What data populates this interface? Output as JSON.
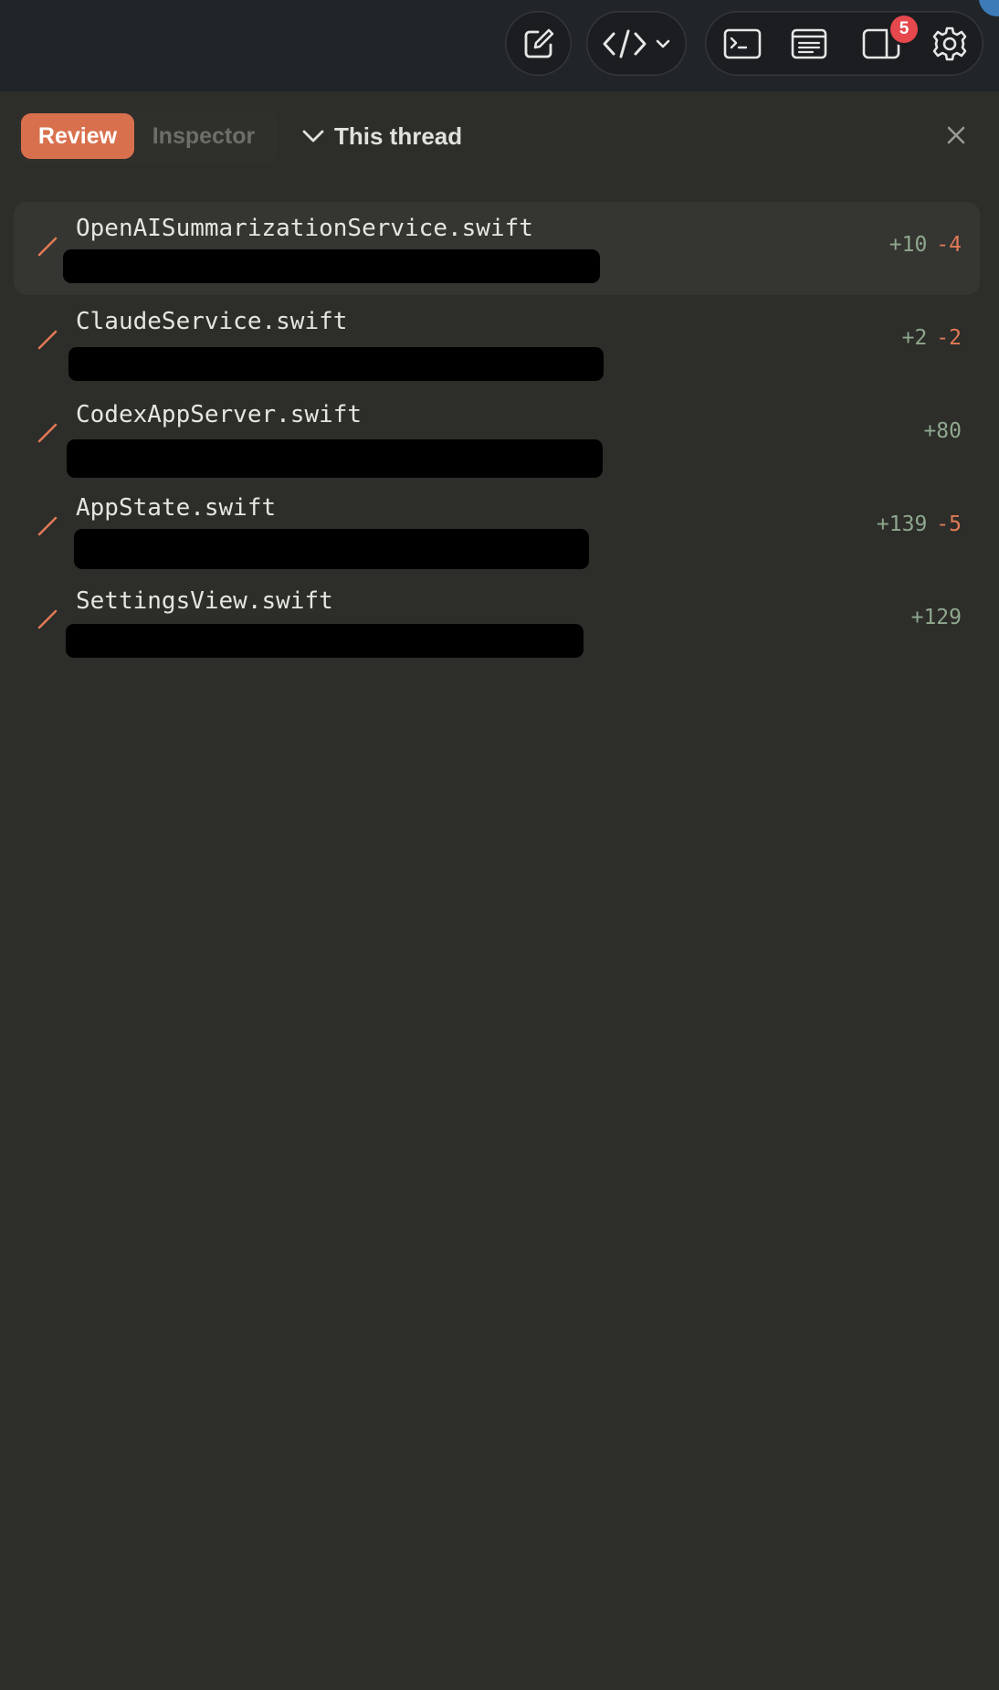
{
  "toolbar": {
    "icons": [
      "compose-icon",
      "code-icon",
      "chevron-down-icon",
      "terminal-icon",
      "document-icon",
      "sidebar-icon",
      "gear-icon"
    ],
    "notification_count": "5"
  },
  "header": {
    "tabs": [
      {
        "label": "Review",
        "active": true
      },
      {
        "label": "Inspector",
        "active": false
      }
    ],
    "scope_label": "This thread",
    "close_icon": "close-icon"
  },
  "files": [
    {
      "name": "OpenAISummarizationService.swift",
      "added": "+10",
      "removed": "-4",
      "selected": true
    },
    {
      "name": "ClaudeService.swift",
      "added": "+2",
      "removed": "-2",
      "selected": false
    },
    {
      "name": "CodexAppServer.swift",
      "added": "+80",
      "removed": "",
      "selected": false
    },
    {
      "name": "AppState.swift",
      "added": "+139",
      "removed": "-5",
      "selected": false
    },
    {
      "name": "SettingsView.swift",
      "added": "+129",
      "removed": "",
      "selected": false
    }
  ],
  "colors": {
    "accent": "#d9704d",
    "added": "#8fa88e",
    "removed": "#e07a56",
    "badge": "#e5484d",
    "background": "#2d2d2a",
    "toolbar": "#212529"
  }
}
